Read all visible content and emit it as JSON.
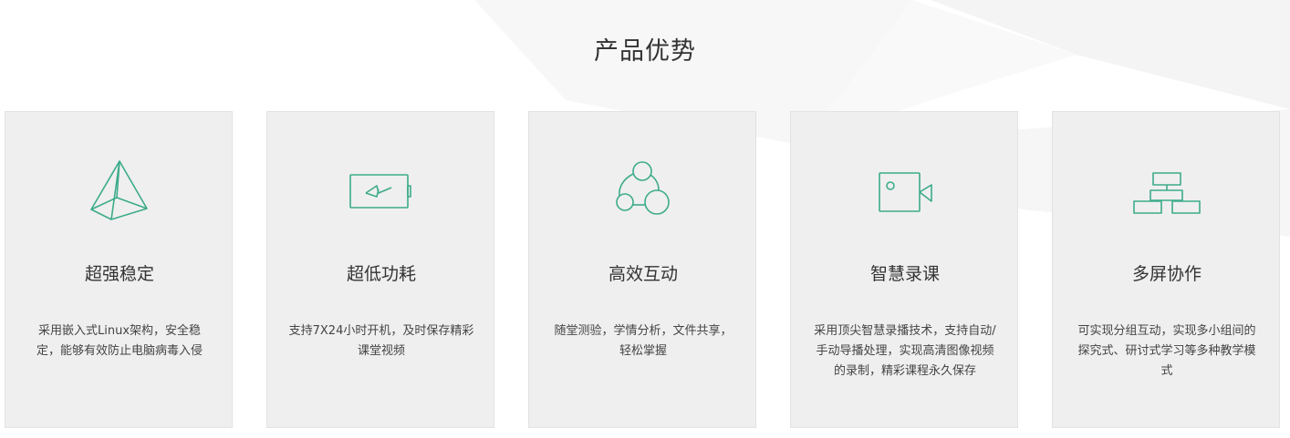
{
  "section": {
    "title": "产品优势"
  },
  "theme": {
    "accent": "#3dab8a",
    "card_bg": "#efefef",
    "card_border": "#e2e2e2"
  },
  "cards": [
    {
      "icon": "pyramid-icon",
      "title": "超强稳定",
      "desc": "采用嵌入式Linux架构，安全稳定，能够有效防止电脑病毒入侵"
    },
    {
      "icon": "battery-icon",
      "title": "超低功耗",
      "desc": "支持7X24小时开机，及时保存精彩课堂视频"
    },
    {
      "icon": "interaction-circles-icon",
      "title": "高效互动",
      "desc": "随堂测验，学情分析，文件共享，轻松掌握"
    },
    {
      "icon": "video-camera-icon",
      "title": "智慧录课",
      "desc": "采用顶尖智慧录播技术，支持自动/手动导播处理，实现高清图像视频的录制，精彩课程永久保存"
    },
    {
      "icon": "hierarchy-icon",
      "title": "多屏协作",
      "desc": "可实现分组互动，实现多小组间的探究式、研讨式学习等多种教学模式"
    }
  ]
}
